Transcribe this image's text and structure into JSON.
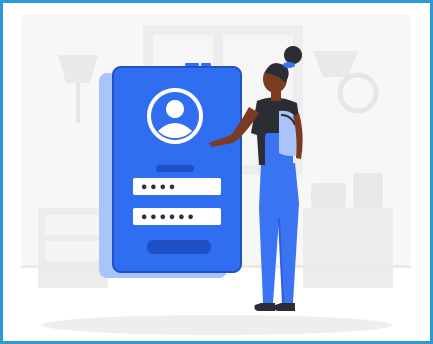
{
  "scene": "login",
  "login_form": {
    "username_masked": "••••",
    "password_masked": "••••••"
  },
  "colors": {
    "border": "#2d9ad6",
    "phone": "#2f6ef0",
    "phone_dark": "#1f50c6",
    "phone_back": "#a9c4fb",
    "skin": "#7a3b22",
    "shirt": "#2c2c34",
    "overalls": "#3a74f2",
    "room": "#f3f3f3"
  },
  "icons": [
    "user-avatar-icon"
  ]
}
